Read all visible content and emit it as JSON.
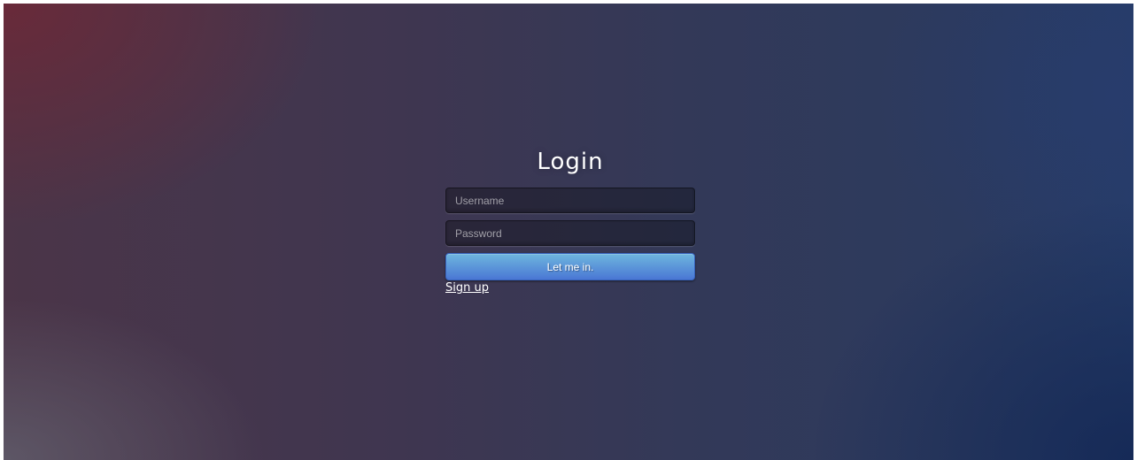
{
  "login": {
    "title": "Login",
    "username_placeholder": "Username",
    "password_placeholder": "Password",
    "submit_label": "Let me in.",
    "signup_label": "Sign up"
  },
  "colors": {
    "button_top": "#6eb6de",
    "button_bottom": "#4a77d4",
    "background_left": "#6e2837",
    "background_right": "#263c68"
  }
}
